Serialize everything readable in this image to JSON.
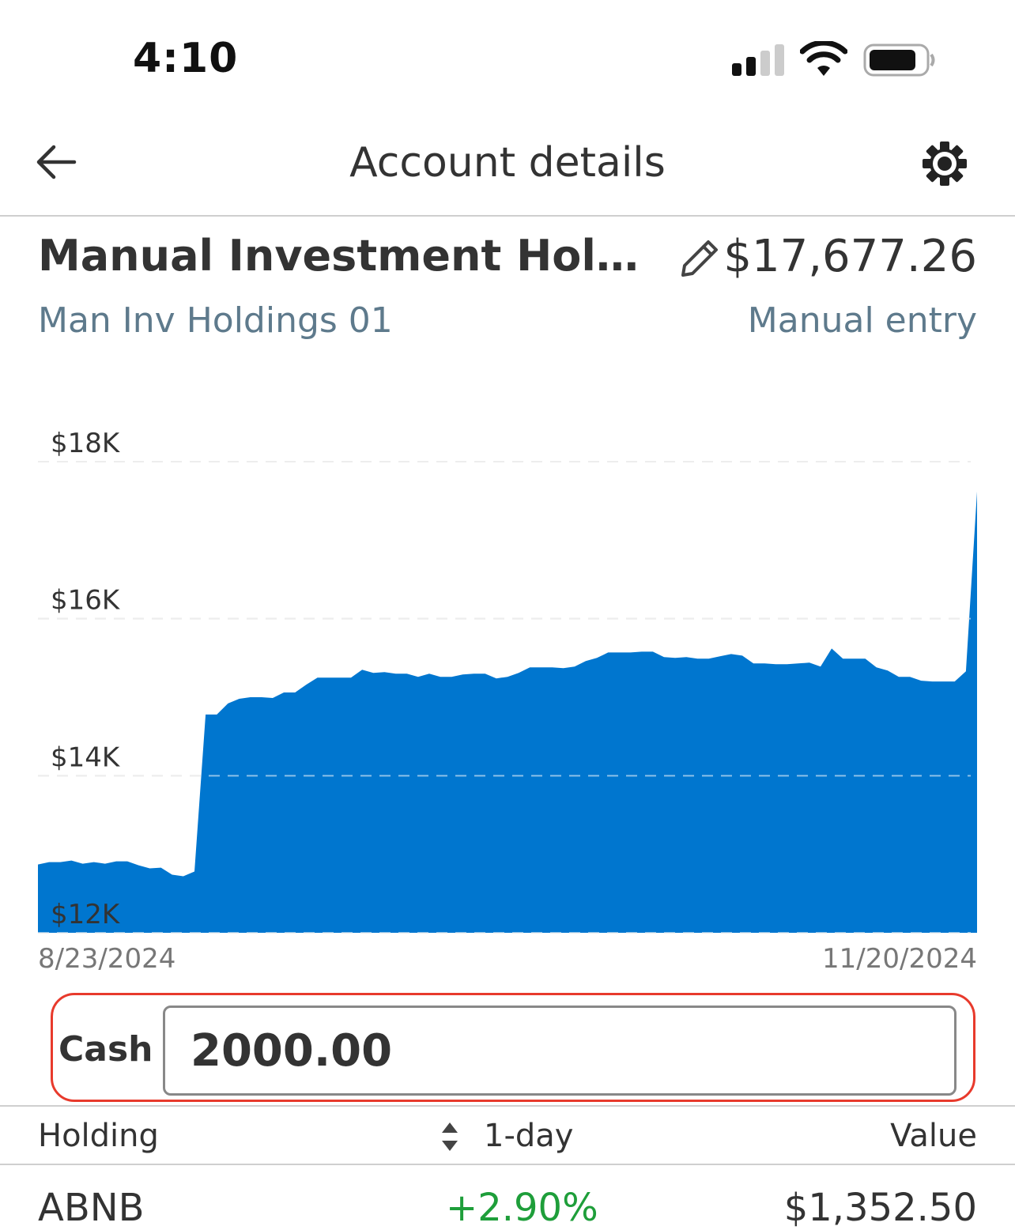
{
  "status_bar": {
    "time": "4:10"
  },
  "header": {
    "title": "Account details"
  },
  "account": {
    "name": "Manual Investment Holdi...",
    "balance": "$17,677.26",
    "subtitle": "Man Inv Holdings 01",
    "source": "Manual entry"
  },
  "chart_data": {
    "type": "area",
    "color": "#0076cf",
    "ylim": [
      12000,
      18000
    ],
    "y_ticks": [
      12000,
      14000,
      16000,
      18000
    ],
    "y_tick_labels": [
      "$12K",
      "$14K",
      "$16K",
      "$18K"
    ],
    "x_start_label": "8/23/2024",
    "x_end_label": "11/20/2024",
    "grid": "dashed horizontal",
    "values": [
      12870,
      12900,
      12900,
      12920,
      12880,
      12900,
      12880,
      12910,
      12910,
      12860,
      12820,
      12830,
      12740,
      12720,
      12780,
      14780,
      14780,
      14920,
      14980,
      15000,
      15000,
      14990,
      15060,
      15060,
      15160,
      15250,
      15250,
      15250,
      15250,
      15350,
      15310,
      15320,
      15300,
      15300,
      15260,
      15300,
      15260,
      15260,
      15290,
      15300,
      15300,
      15240,
      15260,
      15310,
      15380,
      15380,
      15380,
      15370,
      15390,
      15460,
      15500,
      15570,
      15570,
      15570,
      15580,
      15580,
      15510,
      15500,
      15510,
      15490,
      15490,
      15520,
      15550,
      15530,
      15430,
      15430,
      15420,
      15420,
      15430,
      15440,
      15390,
      15620,
      15490,
      15490,
      15490,
      15380,
      15340,
      15260,
      15260,
      15210,
      15200,
      15200,
      15200,
      15330,
      17620
    ]
  },
  "cash": {
    "label": "Cash",
    "value": "2000.00"
  },
  "holdings": {
    "columns": {
      "holding": "Holding",
      "one_day": "1-day",
      "value": "Value"
    },
    "rows": [
      {
        "ticker": "ABNB",
        "change": "+2.90%",
        "value": "$1,352.50"
      }
    ]
  }
}
